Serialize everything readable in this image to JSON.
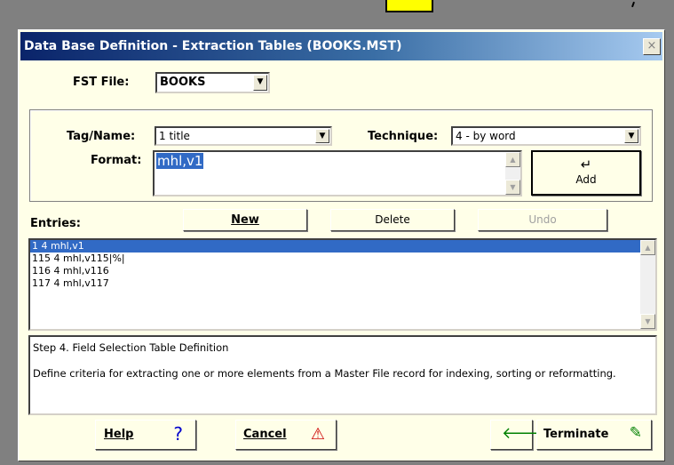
{
  "window": {
    "title": "Data Base Definition - Extraction Tables (BOOKS.MST)",
    "close_glyph": "×"
  },
  "fst": {
    "label": "FST File:",
    "value": "BOOKS"
  },
  "tag": {
    "label": "Tag/Name:",
    "value": "1 title"
  },
  "technique": {
    "label": "Technique:",
    "value": "4 - by word"
  },
  "format": {
    "label": "Format:",
    "value": "mhl,v1"
  },
  "add_button": {
    "glyph": "↵",
    "label": "Add"
  },
  "entries": {
    "label": "Entries:",
    "new_label": "New",
    "delete_label": "Delete",
    "undo_label": "Undo",
    "items": [
      "1 4 mhl,v1",
      "115 4 mhl,v115|%|",
      "116 4 mhl,v116",
      "117 4 mhl,v117"
    ]
  },
  "help_text": {
    "step": "Step 4. Field Selection Table Definition",
    "description": "Define criteria for extracting one or more elements from a Master File record for indexing, sorting or reformatting."
  },
  "footer": {
    "help_label": "Help",
    "help_icon": "?",
    "cancel_label": "Cancel",
    "cancel_icon": "⚠",
    "back_icon": "🡐",
    "terminate_label": "Terminate",
    "terminate_icon": "✎"
  },
  "colors": {
    "titlebar": "#0a246a",
    "selection": "#316ac5",
    "dialog_bg": "#ffffe8"
  }
}
